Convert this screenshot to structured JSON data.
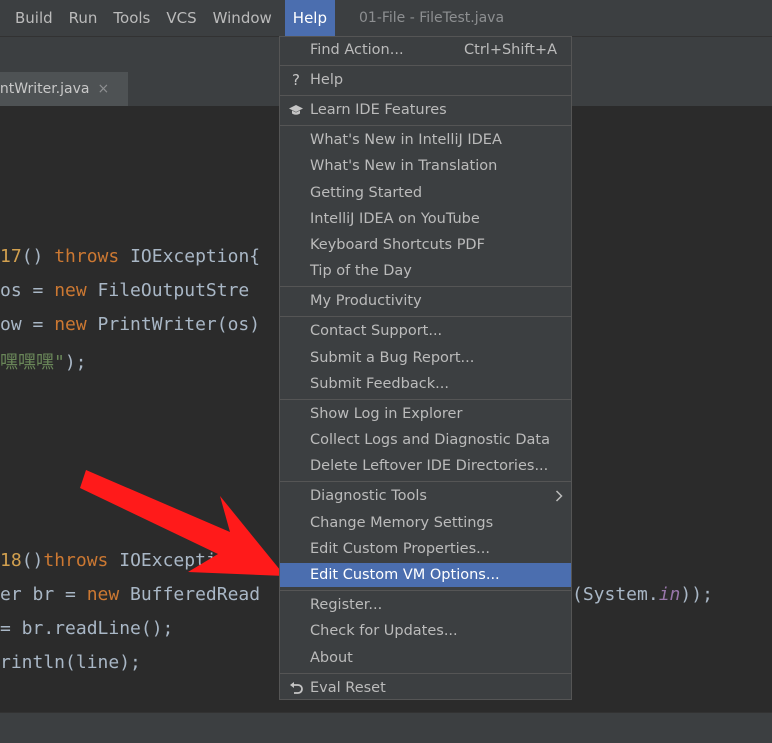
{
  "menubar": {
    "items": [
      "Build",
      "Run",
      "Tools",
      "VCS",
      "Window"
    ],
    "active": "Help",
    "window_title": "01-File - FileTest.java"
  },
  "tab": {
    "name": "intWriter.java",
    "close": "×"
  },
  "code": {
    "l1": {
      "num": "17",
      "rest": "() ",
      "kw": "throws",
      "rest2": " IOException{"
    },
    "l2": {
      "a": "os = ",
      "kw": "new",
      "b": " FileOutputStre"
    },
    "l3": {
      "a": "ow = ",
      "kw": "new",
      "b": " PrintWriter(os)"
    },
    "l4": {
      "str": "嘿嘿嘿\"",
      "b": ");"
    },
    "l5": {
      "num": "18",
      "rest": "()",
      "kw": "throws",
      "rest2": " IOException{"
    },
    "l6": {
      "a": "er br = ",
      "kw": "new",
      "b": " BufferedRead",
      "c": "(System.",
      "fld": "in",
      "d": "));"
    },
    "l7": {
      "a": "= br.readLine();"
    },
    "l8": {
      "a": "rintln(line);"
    }
  },
  "menu": {
    "find_action": "Find Action...",
    "find_action_shortcut": "Ctrl+Shift+A",
    "help": "Help",
    "learn": "Learn IDE Features",
    "whats_new_idea": "What's New in IntelliJ IDEA",
    "whats_new_translation": "What's New in Translation",
    "getting_started": "Getting Started",
    "youtube": "IntelliJ IDEA on YouTube",
    "shortcuts_pdf": "Keyboard Shortcuts PDF",
    "tip": "Tip of the Day",
    "productivity": "My Productivity",
    "contact": "Contact Support...",
    "bug": "Submit a Bug Report...",
    "feedback": "Submit Feedback...",
    "show_log": "Show Log in Explorer",
    "collect_logs": "Collect Logs and Diagnostic Data",
    "delete_leftover": "Delete Leftover IDE Directories...",
    "diagnostic": "Diagnostic Tools",
    "memory": "Change Memory Settings",
    "custom_props": "Edit Custom Properties...",
    "custom_vm": "Edit Custom VM Options...",
    "register": "Register...",
    "updates": "Check for Updates...",
    "about": "About",
    "eval_reset": "Eval Reset",
    "icons": {
      "help": "question-icon",
      "learn": "graduation-cap-icon",
      "eval_reset": "undo-icon",
      "submenu": "chevron-right-icon"
    },
    "highlight_color": "#4b6eaf"
  }
}
